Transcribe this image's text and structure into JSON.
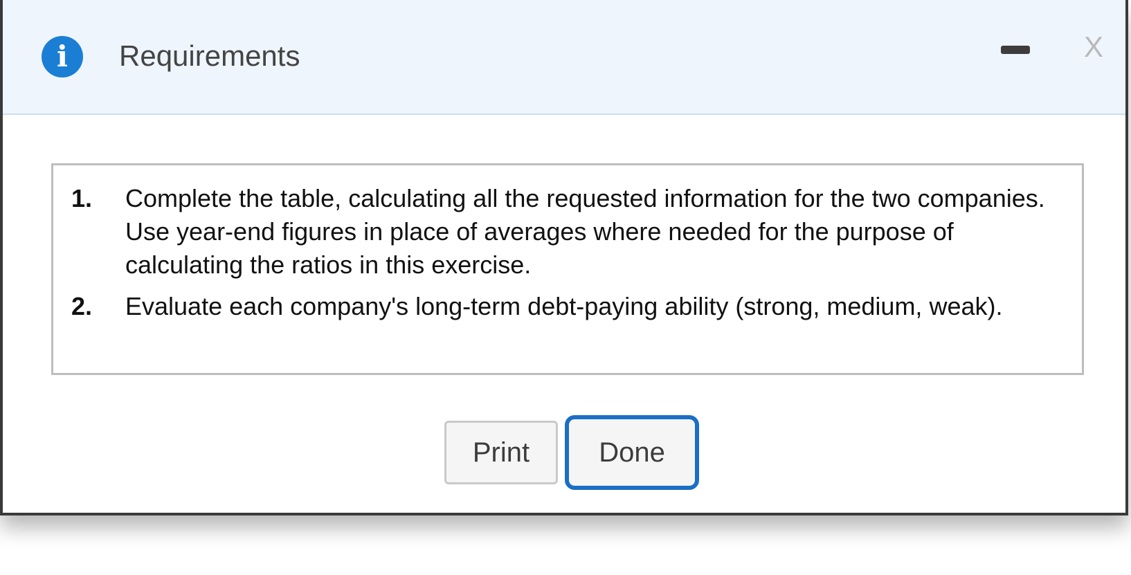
{
  "dialog": {
    "title": "Requirements",
    "info_icon_glyph": "i",
    "close_label": "X",
    "requirements": [
      {
        "number": "1.",
        "text": "Complete the table, calculating all the requested information for the two companies. Use year-end figures in place of averages where needed for the purpose of calculating the ratios in this exercise."
      },
      {
        "number": "2.",
        "text": "Evaluate each company's long-term debt-paying ability (strong, medium, weak)."
      }
    ],
    "buttons": {
      "print_label": "Print",
      "done_label": "Done"
    }
  },
  "icons": {
    "info": "info-circle-icon",
    "minimize": "minimize-icon",
    "close": "close-icon"
  },
  "colors": {
    "header_background": "#eff5fd",
    "accent_blue": "#1a7fd4",
    "focus_border": "#1a6fc4"
  }
}
